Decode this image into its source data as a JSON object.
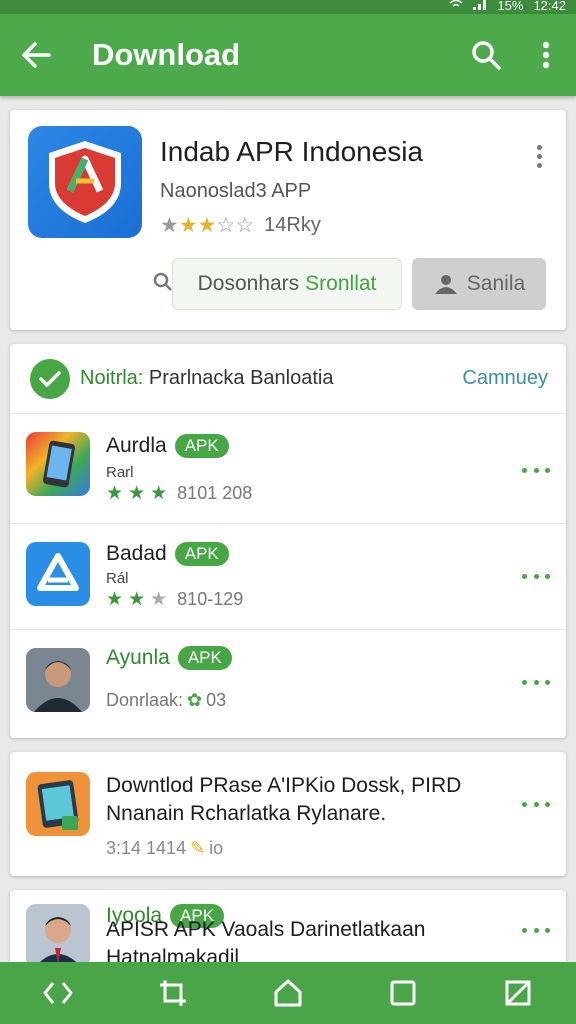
{
  "status": {
    "battery": "15%",
    "time": "12:42"
  },
  "appbar": {
    "title": "Download"
  },
  "featured": {
    "title": "Indab APR Indonesia",
    "subtitle": "Naonoslad3 APP",
    "rating": 3,
    "rating_max": 5,
    "rating_count": "14Rky",
    "download_label_1": "Dosonhars",
    "download_label_2": "Sronllat",
    "secondary_label": "Sanila"
  },
  "list_section": {
    "header_prefix": "Noitrla:",
    "header_rest": "Prarlnacka Banloatia",
    "link_label": "Camnuey",
    "items": [
      {
        "name": "Aurdla",
        "badge": "APK",
        "sub": "Rarl",
        "stars": 3,
        "stars_max": 3,
        "meta": "8101 208",
        "icon": "phone-app-icon"
      },
      {
        "name": "Badad",
        "badge": "APK",
        "sub": "Rál",
        "stars": 2,
        "stars_max": 3,
        "meta": "810-129",
        "icon": "blue-a-app-icon"
      },
      {
        "name": "Ayunla",
        "badge": "APK",
        "meta_prefix": "Donrlaak:",
        "meta": "03",
        "icon": "person-avatar-icon"
      }
    ]
  },
  "card3": {
    "line1": "Downtlod PRase A'IPKio Dossk, PIRD",
    "line2": "Nnanain Rcharlatka Rylanare.",
    "meta": "3:14 1414",
    "meta_suffix": "io"
  },
  "card4": {
    "name": "Iyoola",
    "badge": "APK",
    "line1": "APISR APK Vaoals Darinetlatkaan",
    "line2": "Hatnalmakadil"
  },
  "colors": {
    "primary": "#4caa4a",
    "accent": "#46a744",
    "star": "#e8b52a"
  }
}
